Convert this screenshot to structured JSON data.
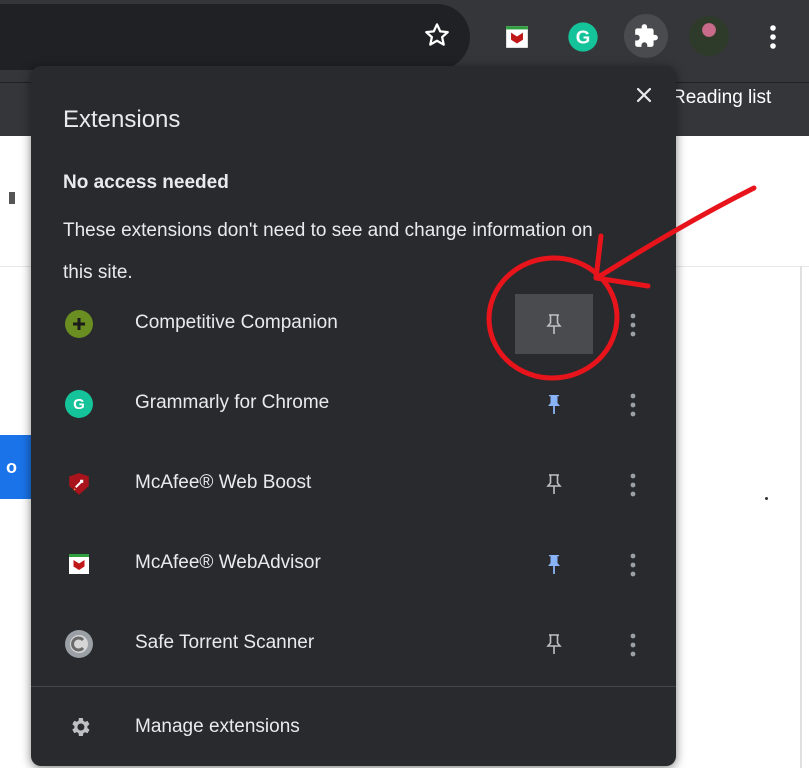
{
  "toolbar": {
    "bookmarks_reading_list": "Reading list",
    "partial_reading_list_prefix": "R"
  },
  "popup": {
    "title": "Extensions",
    "section_heading": "No access needed",
    "section_description": "These extensions don't need to see and change information on this site.",
    "extensions": [
      {
        "name": "Competitive Companion",
        "icon": "plus-circle-icon",
        "color": "#6b8e23",
        "pinned": false
      },
      {
        "name": "Grammarly for Chrome",
        "icon": "grammarly-icon",
        "color": "#15c39a",
        "pinned": true
      },
      {
        "name": "McAfee® Web Boost",
        "icon": "mcafee-rocket-icon",
        "color": "#c01818",
        "pinned": false
      },
      {
        "name": "McAfee® WebAdvisor",
        "icon": "mcafee-shield-icon",
        "color": "#c01818",
        "pinned": true
      },
      {
        "name": "Safe Torrent Scanner",
        "icon": "torrent-scanner-icon",
        "color": "#9aa0a6",
        "pinned": false
      }
    ],
    "manage_label": "Manage extensions"
  },
  "colors": {
    "pin_active": "#8ab4f8",
    "pin_inactive": "#bdc1c6",
    "annotation": "#e8141c"
  }
}
